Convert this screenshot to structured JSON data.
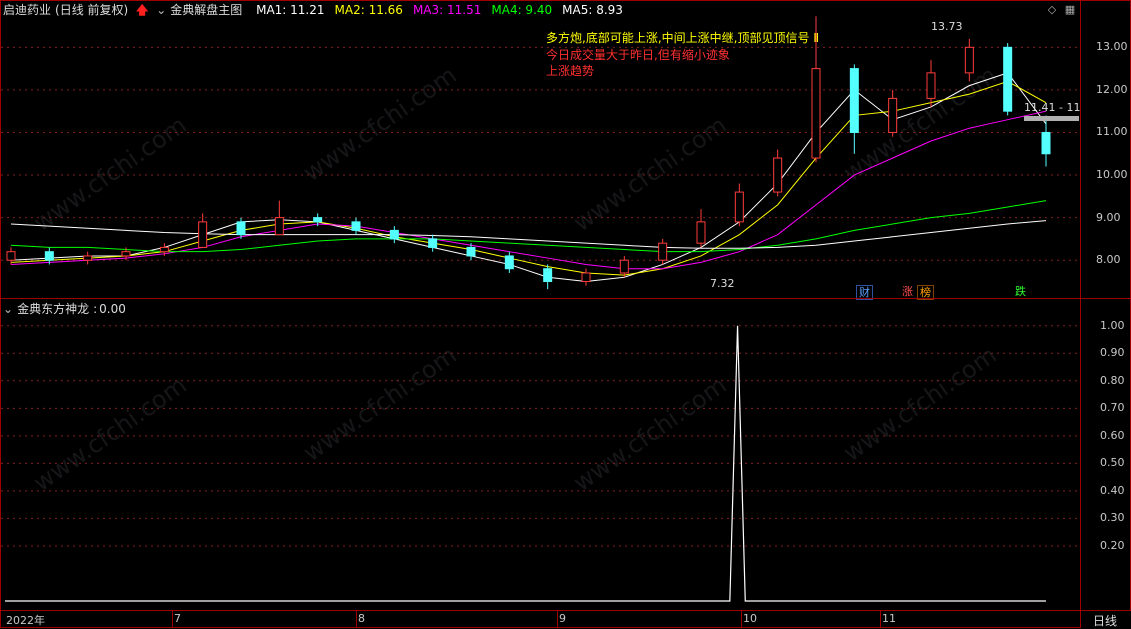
{
  "top_panel": {
    "stock_name": "启迪药业",
    "period": "(日线 前复权)",
    "indicator": "金典解盘主图",
    "ma": [
      {
        "label": "MA1: 11.21",
        "color": "#ffffff"
      },
      {
        "label": "MA2: 11.66",
        "color": "#ffff00"
      },
      {
        "label": "MA3: 11.51",
        "color": "#ff00ff"
      },
      {
        "label": "MA4: 9.40",
        "color": "#00ff00"
      },
      {
        "label": "MA5: 8.93",
        "color": "#ffffff"
      }
    ],
    "annotations": [
      {
        "text": "多方炮,底部可能上涨,中间上涨中继,顶部见顶信号 Ⅱ",
        "color": "#ffff00"
      },
      {
        "text": "今日成交量大于昨日,但有缩小迹象",
        "color": "#ff3030"
      },
      {
        "text": "上涨趋势",
        "color": "#ff3030"
      }
    ],
    "high_label": "13.73",
    "low_label": "7.32",
    "price_tag": "11.41 - 11",
    "tags": [
      {
        "text": "财",
        "color": "#5aa0ff"
      },
      {
        "text": "涨",
        "color": "#ff5050"
      },
      {
        "text": "榜",
        "color": "#ffa000"
      },
      {
        "text": "跌",
        "color": "#30ff30"
      }
    ],
    "y_ticks": [
      "13.00",
      "12.00",
      "11.00",
      "10.00",
      "9.00",
      "8.00"
    ]
  },
  "bottom_panel": {
    "indicator": "金典东方神龙",
    "value": "0.00",
    "y_ticks": [
      "1.00",
      "0.90",
      "0.80",
      "0.70",
      "0.60",
      "0.50",
      "0.40",
      "0.30",
      "0.20"
    ]
  },
  "x_axis": {
    "labels": [
      "2022年",
      "7",
      "8",
      "9",
      "10",
      "11"
    ],
    "period_tab": "日线"
  },
  "watermark": "www.cfchi.com",
  "chart_data": [
    {
      "type": "line",
      "title": "金典解盘主图",
      "ylim": [
        7.3,
        13.9
      ],
      "series": [
        {
          "name": "MA1: 11.21",
          "values": [
            8.0,
            8.05,
            8.1,
            8.1,
            8.3,
            8.6,
            8.9,
            8.95,
            8.9,
            8.7,
            8.5,
            8.3,
            8.1,
            7.9,
            7.6,
            7.5,
            7.6,
            7.9,
            8.3,
            8.9,
            9.8,
            11.0,
            12.0,
            11.3,
            11.6,
            12.1,
            12.4,
            11.2
          ]
        },
        {
          "name": "MA2: 11.66",
          "values": [
            7.95,
            8.0,
            8.05,
            8.1,
            8.2,
            8.45,
            8.7,
            8.85,
            8.9,
            8.75,
            8.55,
            8.4,
            8.25,
            8.05,
            7.85,
            7.7,
            7.65,
            7.8,
            8.1,
            8.6,
            9.3,
            10.4,
            11.4,
            11.5,
            11.7,
            11.9,
            12.2,
            11.7
          ]
        },
        {
          "name": "MA3: 11.51",
          "values": [
            7.9,
            7.95,
            8.0,
            8.05,
            8.15,
            8.3,
            8.55,
            8.7,
            8.85,
            8.8,
            8.65,
            8.5,
            8.35,
            8.2,
            8.05,
            7.9,
            7.8,
            7.8,
            7.95,
            8.2,
            8.6,
            9.3,
            10.0,
            10.4,
            10.8,
            11.1,
            11.3,
            11.5
          ]
        },
        {
          "name": "MA4: 9.40",
          "values": [
            8.35,
            8.3,
            8.3,
            8.25,
            8.2,
            8.2,
            8.25,
            8.35,
            8.45,
            8.5,
            8.5,
            8.5,
            8.45,
            8.4,
            8.35,
            8.3,
            8.25,
            8.2,
            8.2,
            8.25,
            8.35,
            8.5,
            8.7,
            8.85,
            9.0,
            9.1,
            9.25,
            9.4
          ]
        },
        {
          "name": "MA5: 8.93",
          "values": [
            8.85,
            8.8,
            8.75,
            8.7,
            8.65,
            8.62,
            8.6,
            8.6,
            8.6,
            8.6,
            8.6,
            8.58,
            8.55,
            8.5,
            8.45,
            8.4,
            8.35,
            8.3,
            8.28,
            8.28,
            8.3,
            8.35,
            8.45,
            8.55,
            8.65,
            8.75,
            8.85,
            8.93
          ]
        }
      ],
      "candles": [
        {
          "o": 8.0,
          "c": 8.2,
          "h": 8.3,
          "l": 7.9
        },
        {
          "o": 8.2,
          "c": 8.0,
          "h": 8.3,
          "l": 7.9
        },
        {
          "o": 8.0,
          "c": 8.1,
          "h": 8.2,
          "l": 7.9
        },
        {
          "o": 8.1,
          "c": 8.2,
          "h": 8.3,
          "l": 8.0
        },
        {
          "o": 8.2,
          "c": 8.3,
          "h": 8.4,
          "l": 8.1
        },
        {
          "o": 8.3,
          "c": 8.9,
          "h": 9.1,
          "l": 8.3
        },
        {
          "o": 8.9,
          "c": 8.6,
          "h": 9.0,
          "l": 8.5
        },
        {
          "o": 8.6,
          "c": 9.0,
          "h": 9.4,
          "l": 8.6
        },
        {
          "o": 9.0,
          "c": 8.9,
          "h": 9.1,
          "l": 8.8
        },
        {
          "o": 8.9,
          "c": 8.7,
          "h": 9.0,
          "l": 8.6
        },
        {
          "o": 8.7,
          "c": 8.5,
          "h": 8.8,
          "l": 8.4
        },
        {
          "o": 8.5,
          "c": 8.3,
          "h": 8.6,
          "l": 8.2
        },
        {
          "o": 8.3,
          "c": 8.1,
          "h": 8.4,
          "l": 8.0
        },
        {
          "o": 8.1,
          "c": 7.8,
          "h": 8.2,
          "l": 7.7
        },
        {
          "o": 7.8,
          "c": 7.5,
          "h": 7.9,
          "l": 7.32
        },
        {
          "o": 7.5,
          "c": 7.7,
          "h": 7.8,
          "l": 7.4
        },
        {
          "o": 7.7,
          "c": 8.0,
          "h": 8.1,
          "l": 7.6
        },
        {
          "o": 8.0,
          "c": 8.4,
          "h": 8.5,
          "l": 7.9
        },
        {
          "o": 8.4,
          "c": 8.9,
          "h": 9.2,
          "l": 8.3
        },
        {
          "o": 8.9,
          "c": 9.6,
          "h": 9.8,
          "l": 8.8
        },
        {
          "o": 9.6,
          "c": 10.4,
          "h": 10.6,
          "l": 9.5
        },
        {
          "o": 10.4,
          "c": 12.5,
          "h": 13.73,
          "l": 10.3
        },
        {
          "o": 12.5,
          "c": 11.0,
          "h": 12.6,
          "l": 10.5
        },
        {
          "o": 11.0,
          "c": 11.8,
          "h": 12.0,
          "l": 10.9
        },
        {
          "o": 11.8,
          "c": 12.4,
          "h": 12.7,
          "l": 11.6
        },
        {
          "o": 12.4,
          "c": 13.0,
          "h": 13.2,
          "l": 12.2
        },
        {
          "o": 13.0,
          "c": 11.5,
          "h": 13.1,
          "l": 11.4
        },
        {
          "o": 11.0,
          "c": 10.5,
          "h": 11.4,
          "l": 10.2
        }
      ]
    },
    {
      "type": "line",
      "title": "金典东方神龙",
      "ylim": [
        0,
        1.05
      ],
      "series": [
        {
          "name": "金典东方神龙",
          "values": [
            0,
            0,
            0,
            0,
            0,
            0,
            0,
            0,
            0,
            0,
            0,
            0,
            0,
            0,
            0,
            0,
            0,
            0,
            0,
            1.0,
            0,
            0,
            0,
            0,
            0,
            0,
            0,
            0
          ]
        }
      ]
    }
  ]
}
